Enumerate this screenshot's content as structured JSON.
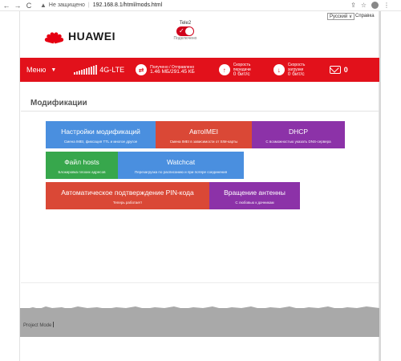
{
  "browser": {
    "back_icon": "←",
    "forward_icon": "→",
    "reload_icon": "C",
    "insecure_label": "Не защищено",
    "url": "192.168.8.1/html/mods.html",
    "share_icon": "⇪",
    "star_icon": "☆",
    "menu_icon": "⋮"
  },
  "header": {
    "language_select": "Русский ∨",
    "help_link": "Справка",
    "brand": "HUAWEI",
    "operator_name": "Tele2",
    "connection_status": "Подключено"
  },
  "redbar": {
    "menu_label": "Меню",
    "menu_arrow": "▼",
    "network_type": "4G-LTE",
    "traffic_label": "Получено / Отправлено",
    "traffic_value": "1.46 МБ/291.45 КБ",
    "upload_label": "Скорость передачи",
    "upload_value": "0 бит/с",
    "download_label": "Скорость загрузки",
    "download_value": "0 бит/с",
    "messages_count": "0",
    "traffic_icon": "⇄",
    "upload_icon": "↑",
    "download_icon": "↓"
  },
  "main": {
    "title": "Модификации",
    "tiles": [
      {
        "title": "Настройки модификаций",
        "desc": "Смена IMEI, фиксация TTL и многое другое",
        "color": "#4a8fdf"
      },
      {
        "title": "АвтоIMEI",
        "desc": "Смена IMEI в зависимости от SIM-карты",
        "color": "#da4836"
      },
      {
        "title": "DHCP",
        "desc": "С возможностью указать DNS-сервера",
        "color": "#8c32a8"
      },
      {
        "title": "Файл hosts",
        "desc": "Блокировка плохих адресов",
        "color": "#37a74c"
      },
      {
        "title": "Watchcat",
        "desc": "Перезагрузка по расписанию и при потере соединения",
        "color": "#4a8fdf"
      },
      {
        "title": "Автоматическое подтверждение PIN-кода",
        "desc": "Теперь работает!",
        "color": "#da4836"
      },
      {
        "title": "Вращение антенны",
        "desc": "С любовью к дачникам",
        "color": "#8c32a8"
      }
    ]
  },
  "footer": {
    "text": "Project Mode"
  }
}
